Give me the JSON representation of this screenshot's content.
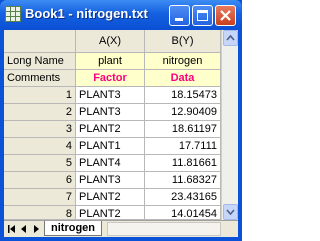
{
  "window": {
    "title": "Book1 - nitrogen.txt"
  },
  "icons": {
    "app": "worksheet-grid-icon",
    "minimize": "minimize-icon",
    "maximize": "maximize-icon",
    "close": "close-icon"
  },
  "worksheet": {
    "columns": [
      {
        "header": "A(X)",
        "long_name": "plant",
        "comments": "Factor"
      },
      {
        "header": "B(Y)",
        "long_name": "nitrogen",
        "comments": "Data"
      }
    ],
    "row_labels": {
      "long_name": "Long Name",
      "comments": "Comments"
    },
    "rows": [
      {
        "n": "1",
        "a": "PLANT3",
        "b": "18.15473"
      },
      {
        "n": "2",
        "a": "PLANT3",
        "b": "12.90409"
      },
      {
        "n": "3",
        "a": "PLANT2",
        "b": "18.61197"
      },
      {
        "n": "4",
        "a": "PLANT1",
        "b": "17.7111"
      },
      {
        "n": "5",
        "a": "PLANT4",
        "b": "11.81661"
      },
      {
        "n": "6",
        "a": "PLANT3",
        "b": "11.68327"
      },
      {
        "n": "7",
        "a": "PLANT2",
        "b": "23.43165"
      },
      {
        "n": "8",
        "a": "PLANT2",
        "b": "14.01454"
      }
    ]
  },
  "sheet_tab": "nitrogen",
  "colors": {
    "titlebar": "#0b4fd4",
    "meta_bg": "#ffffcc",
    "comments_text": "#ff0080"
  }
}
